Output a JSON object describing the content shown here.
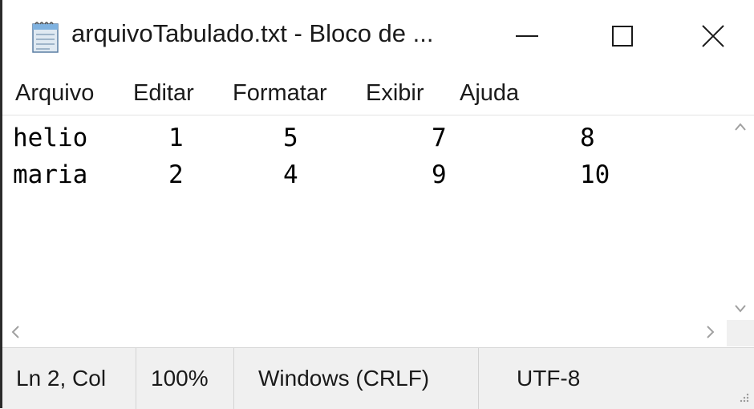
{
  "window": {
    "title": "arquivoTabulado.txt - Bloco de ...",
    "controls": {
      "minimize": "—",
      "maximize": "☐",
      "close": "✕"
    }
  },
  "menu": {
    "items": [
      "Arquivo",
      "Editar",
      "Formatar",
      "Exibir",
      "Ajuda"
    ]
  },
  "editor": {
    "lines": [
      [
        "helio",
        "1",
        "5",
        "7",
        "8"
      ],
      [
        "maria",
        "2",
        "4",
        "9",
        "10"
      ]
    ]
  },
  "status": {
    "position": "Ln 2, Col",
    "zoom": "100%",
    "line_ending": "Windows (CRLF)",
    "encoding": "UTF-8"
  },
  "icons": {
    "app": "notepad-icon",
    "scroll_up": "chevron-up-icon",
    "scroll_down": "chevron-down-icon",
    "scroll_left": "chevron-left-icon",
    "scroll_right": "chevron-right-icon"
  }
}
